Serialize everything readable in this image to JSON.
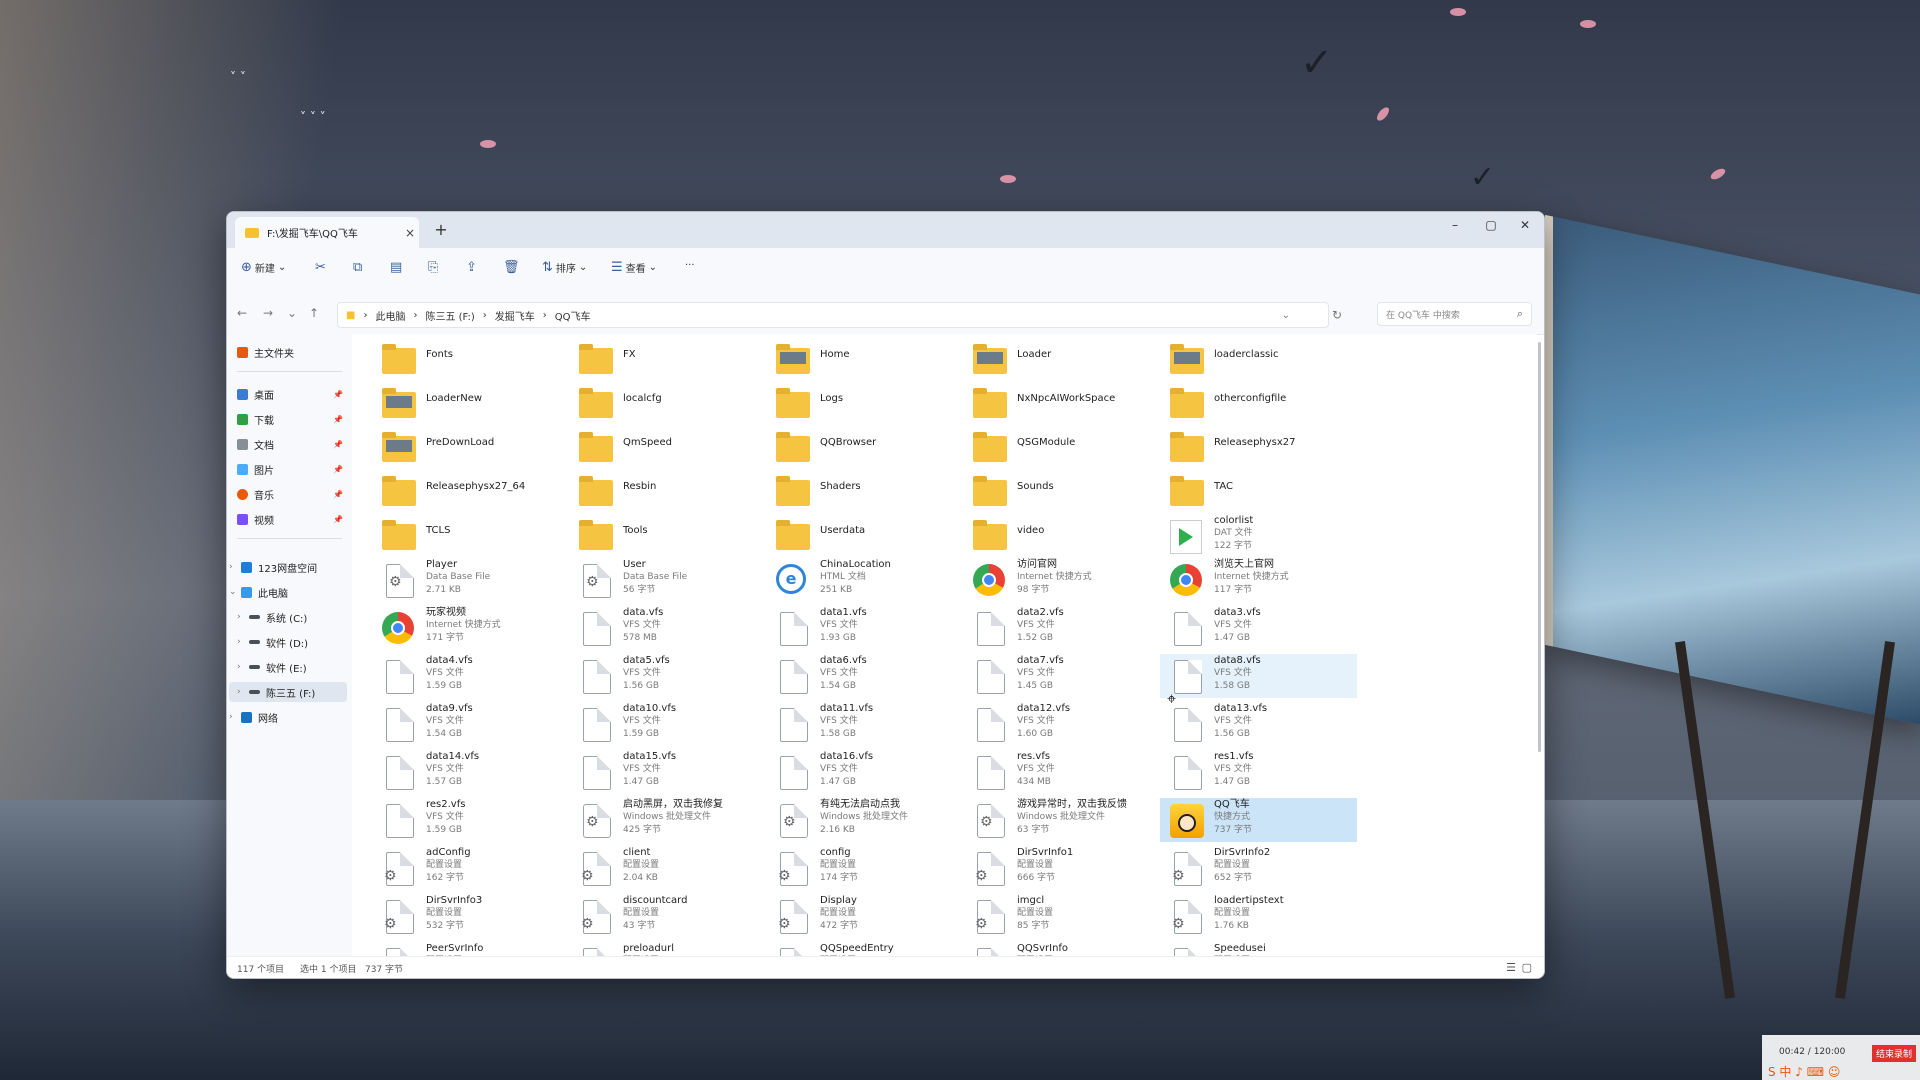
{
  "window": {
    "tab_title": "F:\\发掘飞车\\QQ飞车",
    "tab_close": "×",
    "new_tab": "+",
    "minimize": "–",
    "maximize": "▢",
    "close": "✕"
  },
  "toolbar": {
    "new_label": "新建",
    "sort_label": "排序",
    "view_label": "查看",
    "more_label": "···"
  },
  "address": {
    "crumbs": [
      "此电脑",
      "陈三五 (F:)",
      "发掘飞车",
      "QQ飞车"
    ],
    "search_placeholder": "在 QQ飞车 中搜索"
  },
  "sidebar": {
    "home": "主文件夹",
    "quick": [
      {
        "label": "桌面",
        "color": "#3a7bd5"
      },
      {
        "label": "下载",
        "color": "#2f9e44"
      },
      {
        "label": "文档",
        "color": "#868e96"
      },
      {
        "label": "图片",
        "color": "#4dabf7"
      },
      {
        "label": "音乐",
        "color": "#e8590c"
      },
      {
        "label": "视频",
        "color": "#7950f2"
      }
    ],
    "cloud": "123网盘空间",
    "this_pc": "此电脑",
    "drives": [
      "系统 (C:)",
      "软件 (D:)",
      "软件 (E:)",
      "陈三五 (F:)"
    ],
    "network": "网络"
  },
  "files": [
    {
      "name": "Fonts",
      "type": "folder"
    },
    {
      "name": "FX",
      "type": "folder"
    },
    {
      "name": "Home",
      "type": "folder-pv"
    },
    {
      "name": "Loader",
      "type": "folder-pv"
    },
    {
      "name": "loaderclassic",
      "type": "folder-pv"
    },
    {
      "name": "LoaderNew",
      "type": "folder-pv"
    },
    {
      "name": "localcfg",
      "type": "folder"
    },
    {
      "name": "Logs",
      "type": "folder"
    },
    {
      "name": "NxNpcAIWorkSpace",
      "type": "folder"
    },
    {
      "name": "otherconfigfile",
      "type": "folder"
    },
    {
      "name": "PreDownLoad",
      "type": "folder-pv"
    },
    {
      "name": "QmSpeed",
      "type": "folder"
    },
    {
      "name": "QQBrowser",
      "type": "folder"
    },
    {
      "name": "QSGModule",
      "type": "folder"
    },
    {
      "name": "Releasephysx27",
      "type": "folder"
    },
    {
      "name": "Releasephysx27_64",
      "type": "folder"
    },
    {
      "name": "Resbin",
      "type": "folder"
    },
    {
      "name": "Shaders",
      "type": "folder"
    },
    {
      "name": "Sounds",
      "type": "folder"
    },
    {
      "name": "TAC",
      "type": "folder"
    },
    {
      "name": "TCLS",
      "type": "folder"
    },
    {
      "name": "Tools",
      "type": "folder"
    },
    {
      "name": "Userdata",
      "type": "folder"
    },
    {
      "name": "video",
      "type": "folder"
    },
    {
      "name": "colorlist",
      "type": "play",
      "kind": "DAT 文件",
      "size": "122 字节"
    },
    {
      "name": "Player",
      "type": "gear",
      "kind": "Data Base File",
      "size": "2.71 KB"
    },
    {
      "name": "User",
      "type": "gear",
      "kind": "Data Base File",
      "size": "56 字节"
    },
    {
      "name": "ChinaLocation",
      "type": "ie",
      "kind": "HTML 文档",
      "size": "251 KB"
    },
    {
      "name": "访问官网",
      "type": "chrome",
      "kind": "Internet 快捷方式",
      "size": "98 字节"
    },
    {
      "name": "浏览天上官网",
      "type": "chrome",
      "kind": "Internet 快捷方式",
      "size": "117 字节"
    },
    {
      "name": "玩家视频",
      "type": "chrome",
      "kind": "Internet 快捷方式",
      "size": "171 字节"
    },
    {
      "name": "data.vfs",
      "type": "doc",
      "kind": "VFS 文件",
      "size": "578 MB"
    },
    {
      "name": "data1.vfs",
      "type": "doc",
      "kind": "VFS 文件",
      "size": "1.93 GB"
    },
    {
      "name": "data2.vfs",
      "type": "doc",
      "kind": "VFS 文件",
      "size": "1.52 GB"
    },
    {
      "name": "data3.vfs",
      "type": "doc",
      "kind": "VFS 文件",
      "size": "1.47 GB"
    },
    {
      "name": "data4.vfs",
      "type": "doc",
      "kind": "VFS 文件",
      "size": "1.59 GB"
    },
    {
      "name": "data5.vfs",
      "type": "doc",
      "kind": "VFS 文件",
      "size": "1.56 GB"
    },
    {
      "name": "data6.vfs",
      "type": "doc",
      "kind": "VFS 文件",
      "size": "1.54 GB"
    },
    {
      "name": "data7.vfs",
      "type": "doc",
      "kind": "VFS 文件",
      "size": "1.45 GB"
    },
    {
      "name": "data8.vfs",
      "type": "doc",
      "kind": "VFS 文件",
      "size": "1.58 GB",
      "hover": true
    },
    {
      "name": "data9.vfs",
      "type": "doc",
      "kind": "VFS 文件",
      "size": "1.54 GB"
    },
    {
      "name": "data10.vfs",
      "type": "doc",
      "kind": "VFS 文件",
      "size": "1.59 GB"
    },
    {
      "name": "data11.vfs",
      "type": "doc",
      "kind": "VFS 文件",
      "size": "1.58 GB"
    },
    {
      "name": "data12.vfs",
      "type": "doc",
      "kind": "VFS 文件",
      "size": "1.60 GB"
    },
    {
      "name": "data13.vfs",
      "type": "doc",
      "kind": "VFS 文件",
      "size": "1.56 GB"
    },
    {
      "name": "data14.vfs",
      "type": "doc",
      "kind": "VFS 文件",
      "size": "1.57 GB"
    },
    {
      "name": "data15.vfs",
      "type": "doc",
      "kind": "VFS 文件",
      "size": "1.47 GB"
    },
    {
      "name": "data16.vfs",
      "type": "doc",
      "kind": "VFS 文件",
      "size": "1.47 GB"
    },
    {
      "name": "res.vfs",
      "type": "doc",
      "kind": "VFS 文件",
      "size": "434 MB"
    },
    {
      "name": "res1.vfs",
      "type": "doc",
      "kind": "VFS 文件",
      "size": "1.47 GB"
    },
    {
      "name": "res2.vfs",
      "type": "doc",
      "kind": "VFS 文件",
      "size": "1.59 GB"
    },
    {
      "name": "启动黑屏，双击我修复",
      "type": "gear-box",
      "kind": "Windows 批处理文件",
      "size": "425 字节"
    },
    {
      "name": "有纯无法启动点我",
      "type": "gear-box",
      "kind": "Windows 批处理文件",
      "size": "2.16 KB"
    },
    {
      "name": "游戏异常时，双击我反馈",
      "type": "gear-box",
      "kind": "Windows 批处理文件",
      "size": "63 字节"
    },
    {
      "name": "QQ飞车",
      "type": "avatar",
      "kind": "快捷方式",
      "size": "737 字节",
      "selected": true
    },
    {
      "name": "adConfig",
      "type": "cfg",
      "kind": "配置设置",
      "size": "162 字节"
    },
    {
      "name": "client",
      "type": "cfg",
      "kind": "配置设置",
      "size": "2.04 KB"
    },
    {
      "name": "config",
      "type": "cfg",
      "kind": "配置设置",
      "size": "174 字节"
    },
    {
      "name": "DirSvrInfo1",
      "type": "cfg",
      "kind": "配置设置",
      "size": "666 字节"
    },
    {
      "name": "DirSvrInfo2",
      "type": "cfg",
      "kind": "配置设置",
      "size": "652 字节"
    },
    {
      "name": "DirSvrInfo3",
      "type": "cfg",
      "kind": "配置设置",
      "size": "532 字节"
    },
    {
      "name": "discountcard",
      "type": "cfg",
      "kind": "配置设置",
      "size": "43 字节"
    },
    {
      "name": "Display",
      "type": "cfg",
      "kind": "配置设置",
      "size": "472 字节"
    },
    {
      "name": "imgcl",
      "type": "cfg",
      "kind": "配置设置",
      "size": "85 字节"
    },
    {
      "name": "loadertipstext",
      "type": "cfg",
      "kind": "配置设置",
      "size": "1.76 KB"
    },
    {
      "name": "PeerSvrInfo",
      "type": "cfg",
      "kind": "配置设置",
      "size": ""
    },
    {
      "name": "preloadurl",
      "type": "cfg",
      "kind": "配置设置",
      "size": ""
    },
    {
      "name": "QQSpeedEntry",
      "type": "cfg",
      "kind": "配置设置",
      "size": ""
    },
    {
      "name": "QQSvrInfo",
      "type": "cfg",
      "kind": "配置设置",
      "size": ""
    },
    {
      "name": "Speedusei",
      "type": "cfg",
      "kind": "配置设置",
      "size": ""
    }
  ],
  "status": {
    "count": "117 个项目",
    "selected": "选中 1 个项目",
    "size": "737 字节"
  },
  "tray": {
    "timer": "00:42 / 120:00",
    "badge": "结束录制"
  }
}
